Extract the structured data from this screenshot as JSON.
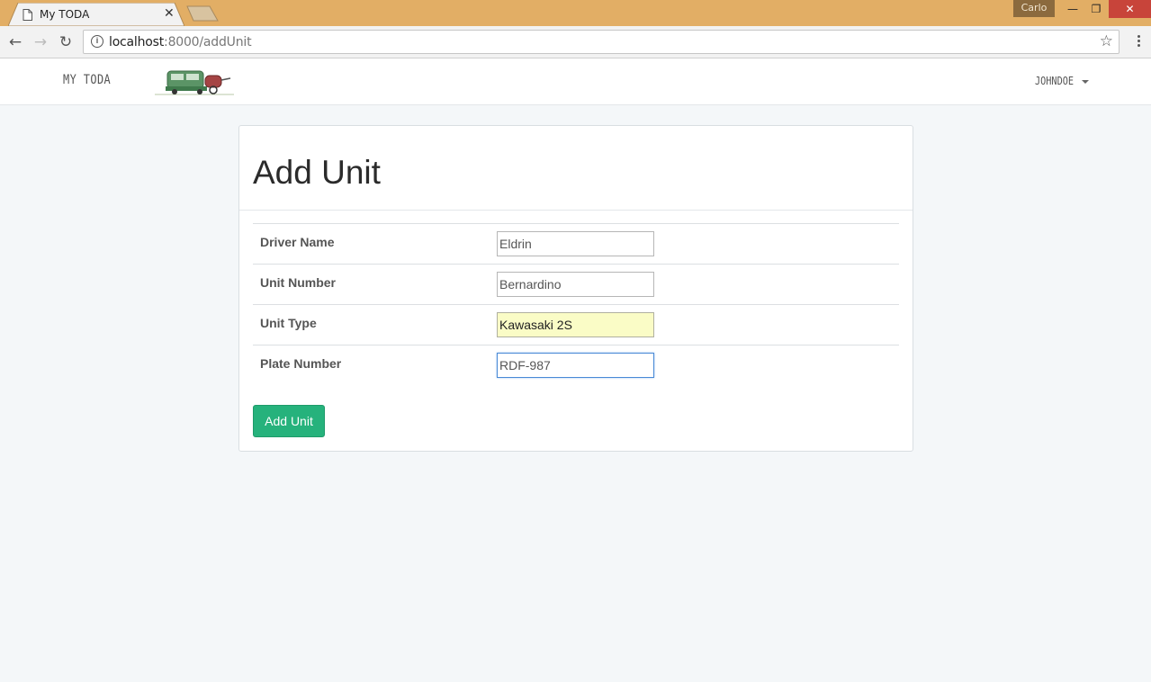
{
  "browser": {
    "tab_title": "My TODA",
    "profile_name": "Carlo",
    "url_host": "localhost",
    "url_path": ":8000/addUnit"
  },
  "app": {
    "brand": "MY TODA",
    "user": "JOHNDOE"
  },
  "form": {
    "title": "Add Unit",
    "fields": [
      {
        "label": "Driver Name",
        "value": "Eldrin"
      },
      {
        "label": "Unit Number",
        "value": "Bernardino"
      },
      {
        "label": "Unit Type",
        "value": "Kawasaki 2S"
      },
      {
        "label": "Plate Number",
        "value": "RDF-987"
      }
    ],
    "submit_label": "Add Unit"
  },
  "colors": {
    "titlebar": "#e2ae65",
    "submit_button": "#26b27c",
    "autofill_bg": "#fafcc6"
  }
}
